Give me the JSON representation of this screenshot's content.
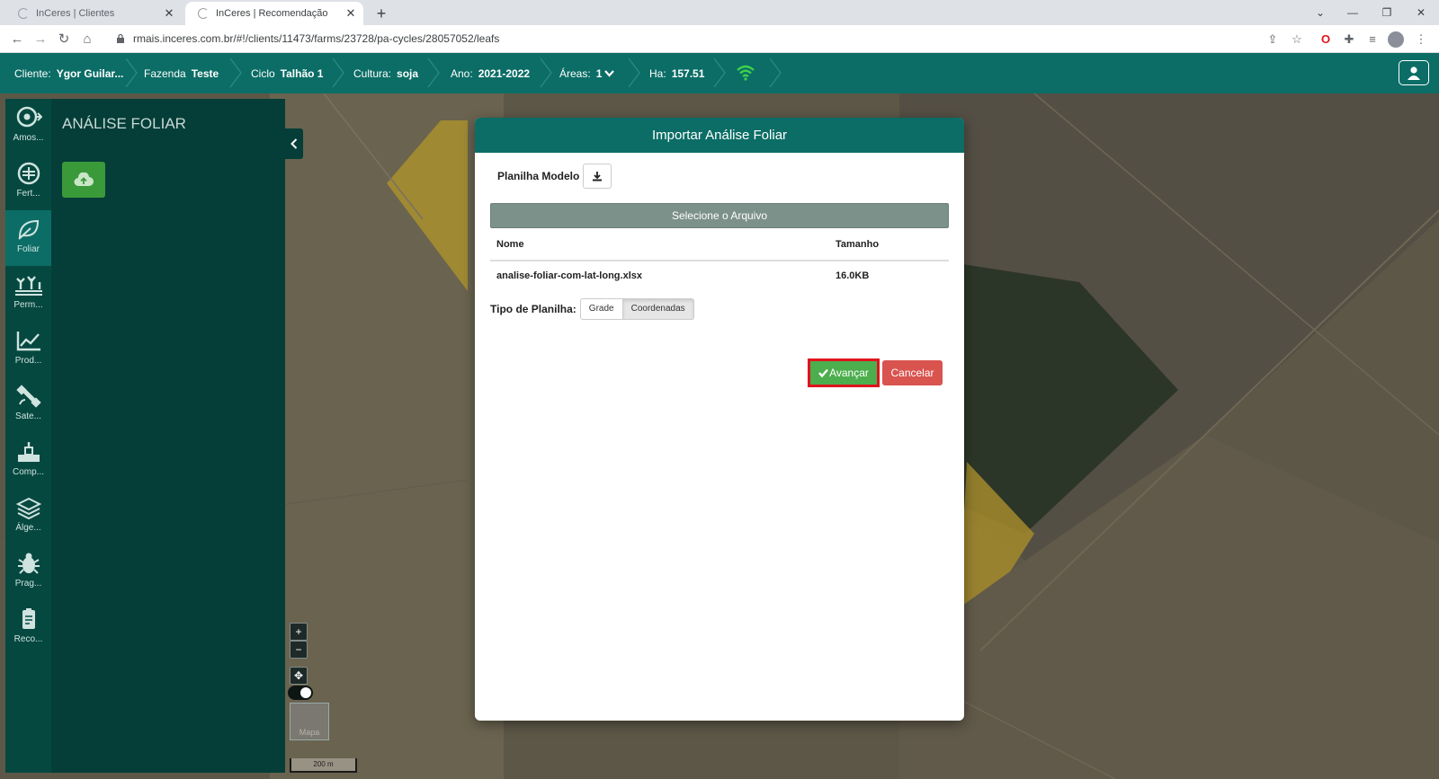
{
  "browser": {
    "tabs": [
      {
        "title": "InCeres | Clientes",
        "active": false
      },
      {
        "title": "InCeres | Recomendação",
        "active": true
      }
    ],
    "url": "rmais.inceres.com.br/#!/clients/11473/farms/23728/pa-cycles/28057052/leafs"
  },
  "header": {
    "crumbs": [
      {
        "label": "Cliente:",
        "value": "Ygor Guilar..."
      },
      {
        "label": "Fazenda",
        "value": "Teste"
      },
      {
        "label": "Ciclo",
        "value": "Talhão 1"
      },
      {
        "label": "Cultura:",
        "value": "soja"
      },
      {
        "label": "Ano:",
        "value": "2021-2022"
      },
      {
        "label": "Áreas:",
        "value": "1"
      },
      {
        "label": "Ha:",
        "value": "157.51"
      }
    ],
    "accent": "#0b6d66"
  },
  "rail": {
    "items": [
      {
        "label": "Amos...",
        "icon": "sample-icon"
      },
      {
        "label": "Fert...",
        "icon": "fertility-icon"
      },
      {
        "label": "Foliar",
        "icon": "leaf-icon",
        "active": true
      },
      {
        "label": "Perm...",
        "icon": "plants-icon"
      },
      {
        "label": "Prod...",
        "icon": "chart-line-icon"
      },
      {
        "label": "Sate...",
        "icon": "satellite-icon"
      },
      {
        "label": "Comp...",
        "icon": "compare-icon"
      },
      {
        "label": "Álge...",
        "icon": "layers-icon"
      },
      {
        "label": "Prag...",
        "icon": "bug-icon"
      },
      {
        "label": "Reco...",
        "icon": "recommendation-icon"
      }
    ]
  },
  "panel": {
    "title": "ANÁLISE FOLIAR"
  },
  "map": {
    "minimap_label": "Mapa",
    "scale_label": "200 m"
  },
  "modal": {
    "title": "Importar Análise Foliar",
    "template_label": "Planilha Modelo",
    "select_file_label": "Selecione o Arquivo",
    "table": {
      "headers": [
        "Nome",
        "Tamanho"
      ],
      "rows": [
        [
          "analise-foliar-com-lat-long.xlsx",
          "16.0KB"
        ]
      ]
    },
    "type_label": "Tipo de Planilha:",
    "type_options": [
      "Grade",
      "Coordenadas"
    ],
    "type_selected": "Coordenadas",
    "advance_label": "Avançar",
    "cancel_label": "Cancelar"
  }
}
